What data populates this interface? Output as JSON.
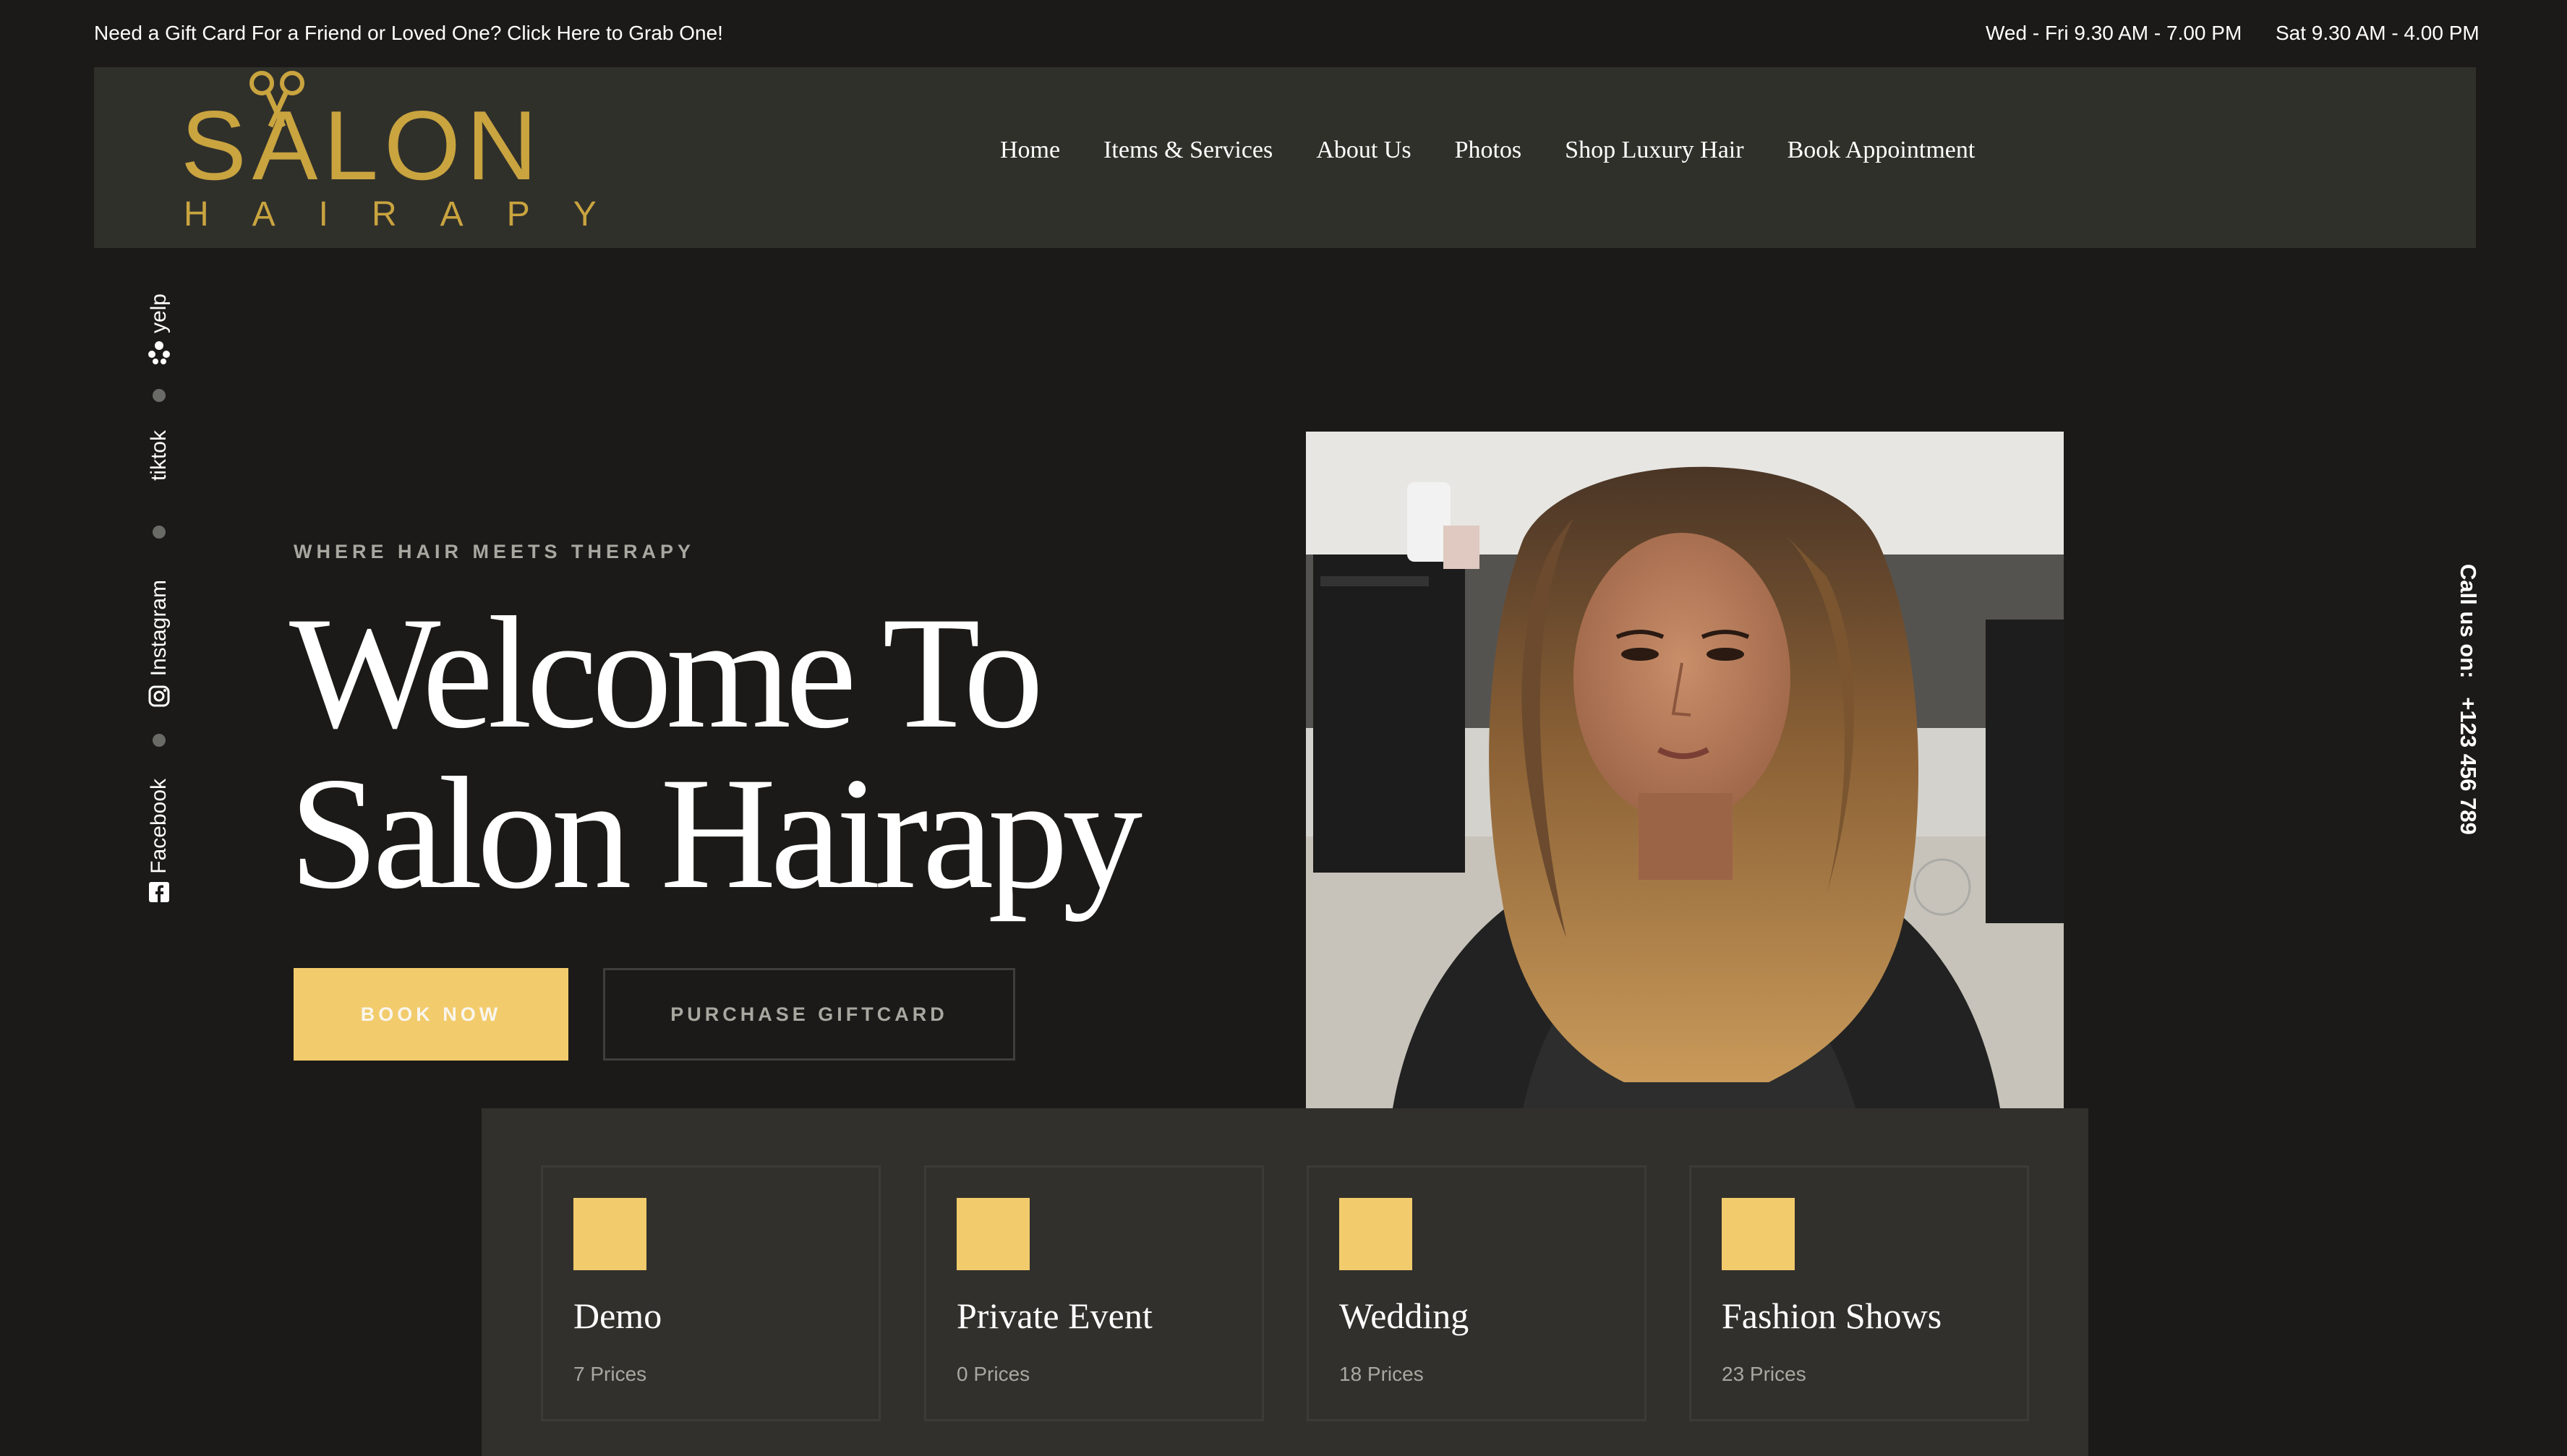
{
  "topbar": {
    "promo": "Need a Gift Card For a Friend or Loved One? Click Here to Grab One!",
    "hours_weekday": "Wed - Fri 9.30 AM - 7.00 PM",
    "hours_saturday": "Sat 9.30 AM - 4.00 PM"
  },
  "logo": {
    "main": "SALON",
    "sub": "HAIRAPY"
  },
  "nav": [
    "Home",
    "Items & Services",
    "About Us",
    "Photos",
    "Shop Luxury Hair",
    "Book Appointment"
  ],
  "social": [
    {
      "label": "yelp",
      "icon": "yelp-icon"
    },
    {
      "label": "tiktok",
      "icon": ""
    },
    {
      "label": "Instagram",
      "icon": "instagram-icon"
    },
    {
      "label": "Facebook",
      "icon": "facebook-icon"
    }
  ],
  "hero": {
    "tagline": "WHERE HAIR MEETS THERAPY",
    "title_line1": "Welcome To",
    "title_line2": "Salon Hairapy",
    "book_button": "BOOK NOW",
    "gift_button": "PURCHASE GIFTCARD"
  },
  "callus": {
    "label": "Call us on:",
    "phone": "+123 456 789"
  },
  "categories": [
    {
      "title": "Demo",
      "subtitle": "7 Prices"
    },
    {
      "title": "Private Event",
      "subtitle": "0 Prices"
    },
    {
      "title": "Wedding",
      "subtitle": "18 Prices"
    },
    {
      "title": "Fashion Shows",
      "subtitle": "23 Prices"
    }
  ],
  "colors": {
    "background": "#1b1a18",
    "panel": "#30302b",
    "accent": "#f2cb6c",
    "logo_gold": "#c9a43f",
    "muted_text": "#a8a7a0"
  }
}
